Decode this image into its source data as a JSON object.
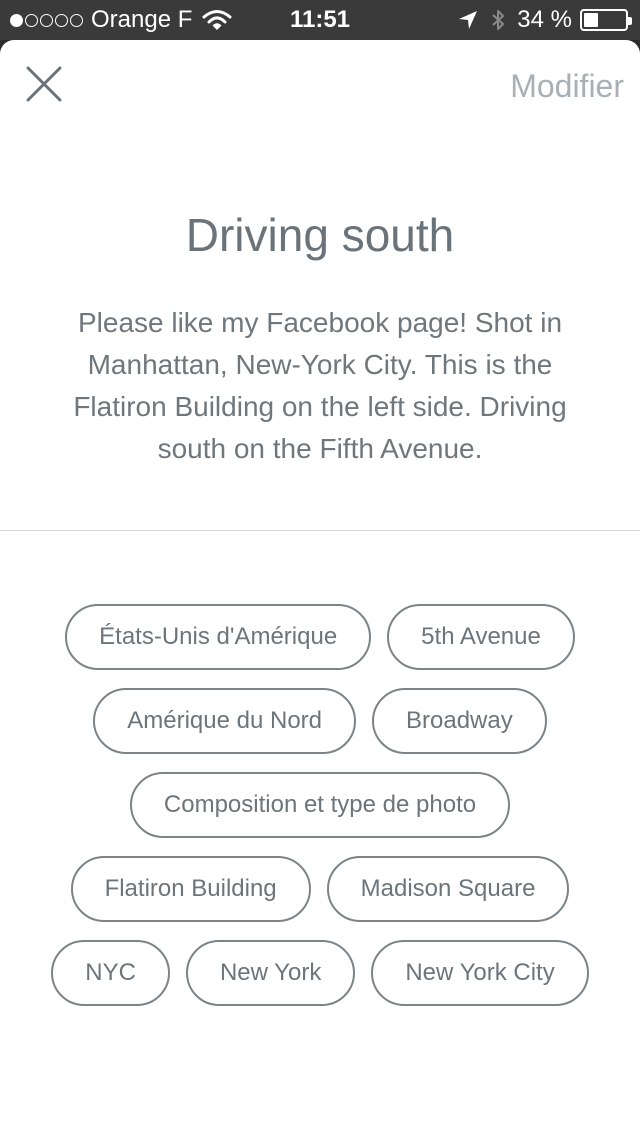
{
  "status_bar": {
    "carrier": "Orange F",
    "signal_strength": 1,
    "time": "11:51",
    "battery_label": "34 %",
    "battery_level": 0.34
  },
  "header": {
    "edit_label": "Modifier"
  },
  "content": {
    "title": "Driving south",
    "description": "Please like my Facebook page! Shot in Manhattan, New-York City. This is the Flatiron Building on the left side. Driving south on the Fifth Avenue."
  },
  "tags": [
    "États-Unis d'Amérique",
    "5th Avenue",
    "Amérique du Nord",
    "Broadway",
    "Composition et type de photo",
    "Flatiron Building",
    "Madison Square",
    "NYC",
    "New York",
    "New York City"
  ]
}
